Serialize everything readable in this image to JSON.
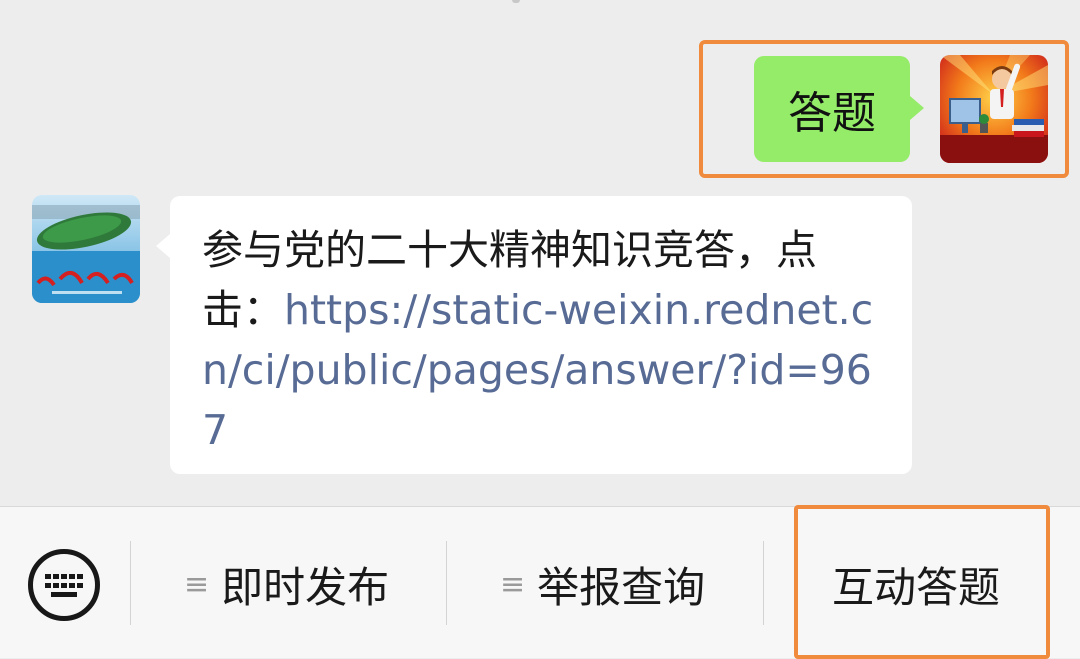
{
  "chat": {
    "outgoing": {
      "text": "答题"
    },
    "incoming": {
      "text_prefix": "参与党的二十大精神知识竞答，点击：",
      "link": "https://static-weixin.rednet.cn/ci/public/pages/answer/?id=967"
    }
  },
  "menu": {
    "item1": "即时发布",
    "item2": "举报查询",
    "item3": "互动答题",
    "burger_glyph": "≡"
  },
  "colors": {
    "out_bubble": "#95ec69",
    "link": "#576b95",
    "highlight": "#f08a3c"
  }
}
